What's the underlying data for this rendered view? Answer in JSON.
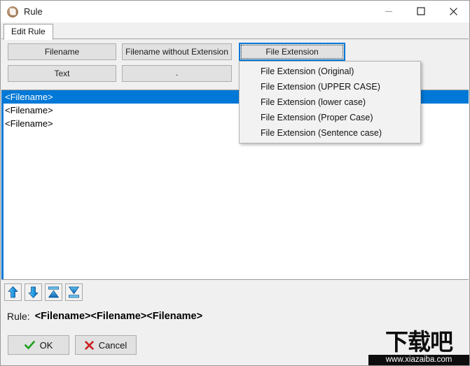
{
  "window": {
    "title": "Rule",
    "icon": "rule-app-icon",
    "controls": {
      "minimize": "minimize-icon",
      "maximize": "maximize-icon",
      "close": "close-icon"
    }
  },
  "tabs": [
    {
      "label": "Edit Rule",
      "active": true
    }
  ],
  "token_buttons": [
    {
      "id": "filename",
      "label": "Filename"
    },
    {
      "id": "filename-without-extension",
      "label": "Filename without Extension"
    },
    {
      "id": "file-extension",
      "label": "File Extension",
      "focused": true
    },
    {
      "id": "text",
      "label": "Text"
    },
    {
      "id": "separator",
      "label": "."
    }
  ],
  "dropdown": {
    "open": true,
    "items": [
      "File Extension (Original)",
      "File Extension (UPPER CASE)",
      "File Extension (lower case)",
      "File Extension (Proper Case)",
      "File Extension (Sentence case)"
    ]
  },
  "list": {
    "rows": [
      {
        "text": "<Filename>",
        "selected": true
      },
      {
        "text": "<Filename>",
        "selected": false
      },
      {
        "text": "<Filename>",
        "selected": false
      }
    ]
  },
  "order_toolbar": [
    {
      "id": "move-up",
      "icon": "arrow-up-icon"
    },
    {
      "id": "move-down",
      "icon": "arrow-down-icon"
    },
    {
      "id": "move-to-top",
      "icon": "arrow-to-top-icon"
    },
    {
      "id": "move-to-bottom",
      "icon": "arrow-to-bottom-icon"
    }
  ],
  "rule_preview": {
    "label": "Rule:",
    "value": "<Filename><Filename><Filename>"
  },
  "actions": {
    "ok": {
      "label": "OK",
      "icon": "check-icon"
    },
    "cancel": {
      "label": "Cancel",
      "icon": "cross-icon"
    }
  },
  "watermark": {
    "brand": "下载吧",
    "url": "www.xiazaiba.com"
  },
  "colors": {
    "accent": "#0078d7",
    "selection": "#0078d7",
    "chrome": "#f0f0f0",
    "button_face": "#e1e1e1",
    "ok_check": "#1ba01b",
    "cancel_cross": "#cc1f1f"
  }
}
